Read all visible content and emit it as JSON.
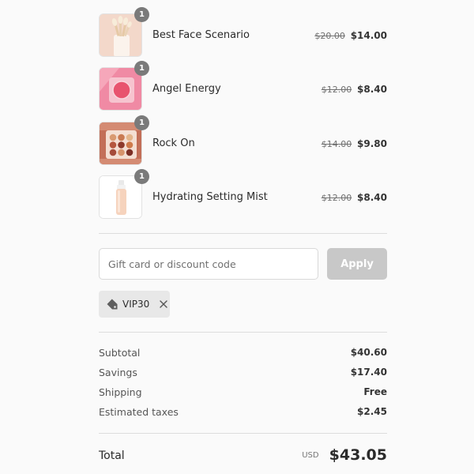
{
  "items": [
    {
      "name": "Best Face Scenario",
      "quantity": "1",
      "original_price": "$20.00",
      "price": "$14.00",
      "image": "makeup-brush-set"
    },
    {
      "name": "Angel Energy",
      "quantity": "1",
      "original_price": "$12.00",
      "price": "$8.40",
      "image": "pink-blush-compact"
    },
    {
      "name": "Rock On",
      "quantity": "1",
      "original_price": "$14.00",
      "price": "$9.80",
      "image": "eyeshadow-palette"
    },
    {
      "name": "Hydrating Setting Mist",
      "quantity": "1",
      "original_price": "$12.00",
      "price": "$8.40",
      "image": "setting-mist-bottle"
    }
  ],
  "discount": {
    "placeholder": "Gift card or discount code",
    "value": "",
    "apply_label": "Apply",
    "applied_code": "VIP30"
  },
  "summary": {
    "subtotal_label": "Subtotal",
    "subtotal_value": "$40.60",
    "savings_label": "Savings",
    "savings_value": "$17.40",
    "shipping_label": "Shipping",
    "shipping_value": "Free",
    "taxes_label": "Estimated taxes",
    "taxes_value": "$2.45"
  },
  "total": {
    "label": "Total",
    "currency": "USD",
    "amount": "$43.05"
  },
  "colors": {
    "apply_disabled": "#c8c8c8",
    "badge": "#7a7a7a",
    "chip_bg": "#e8e8e8"
  }
}
